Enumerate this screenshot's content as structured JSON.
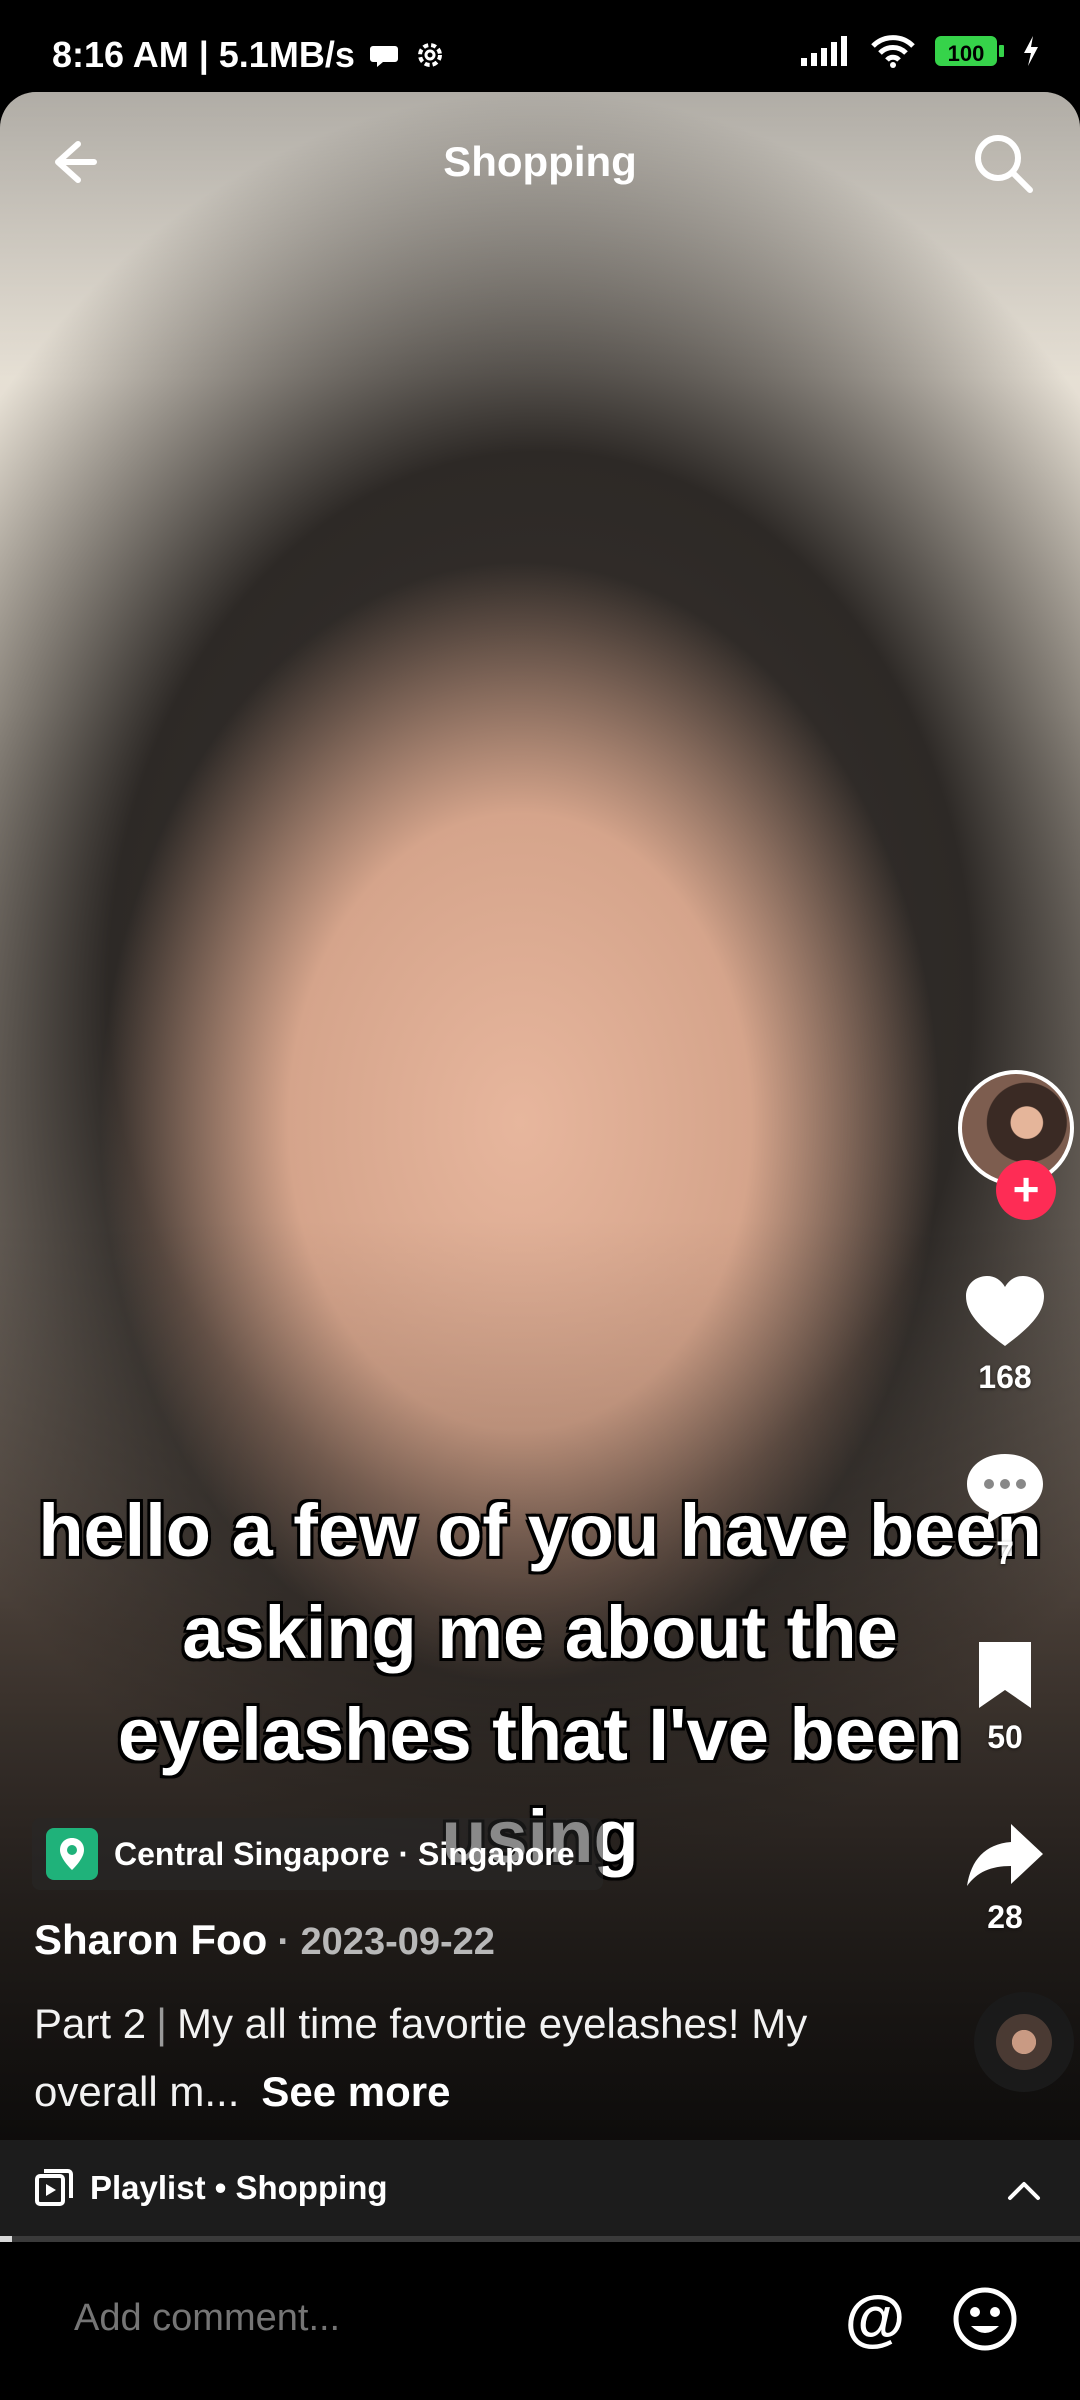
{
  "status_bar": {
    "time_and_speed": "8:16 AM | 5.1MB/s",
    "battery": "100"
  },
  "nav": {
    "title": "Shopping"
  },
  "video": {
    "caption": "hello a few of you have been asking me about the eyelashes that I've been using"
  },
  "actions": {
    "likes": "168",
    "comments": "7",
    "saves": "50",
    "shares": "28"
  },
  "post": {
    "location": "Central Singapore · Singapore",
    "author": "Sharon Foo",
    "date": "· 2023-09-22",
    "part": "Part 2",
    "description": "My all time favortie eyelashes! My overall m...",
    "see_more": "See more"
  },
  "playlist": {
    "label": "Playlist • Shopping"
  },
  "comment_bar": {
    "placeholder": "Add comment..."
  }
}
